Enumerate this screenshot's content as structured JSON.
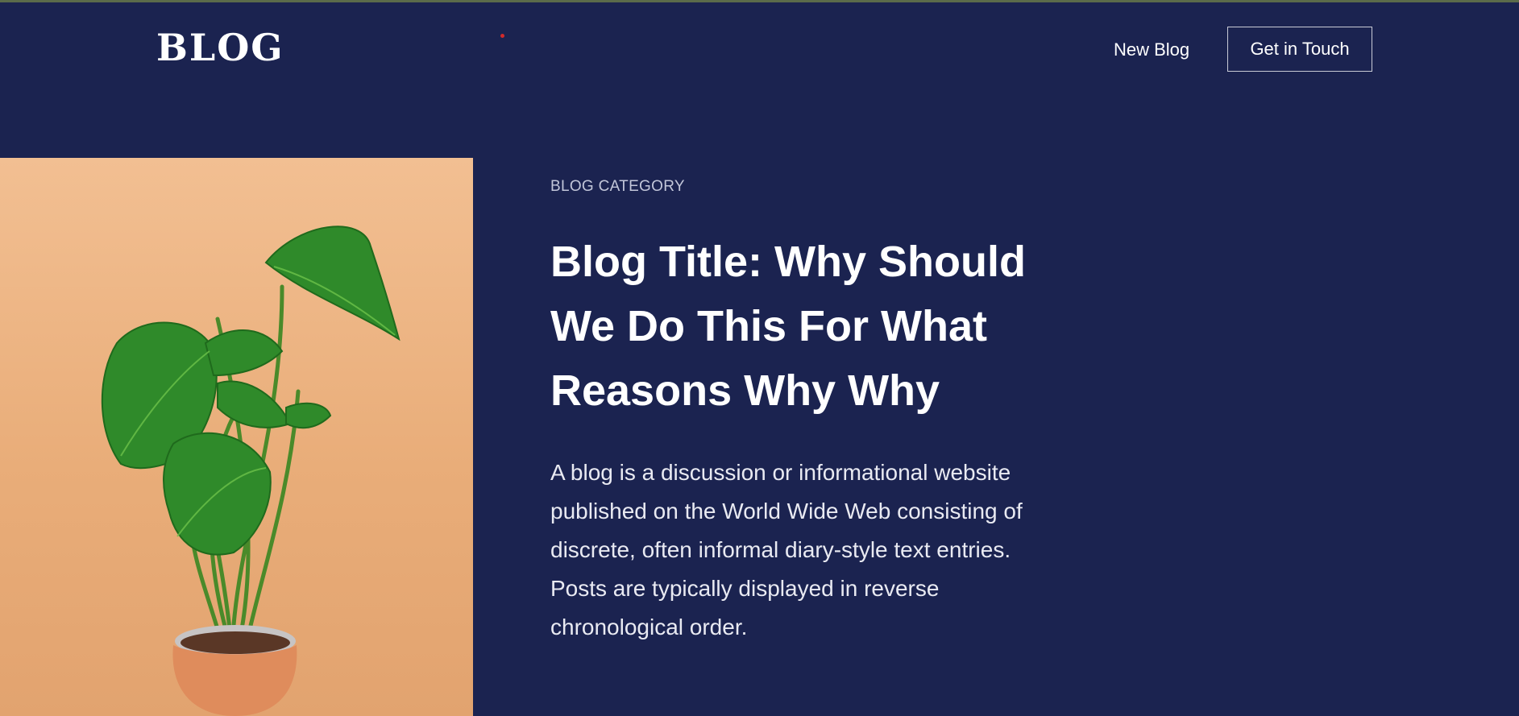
{
  "header": {
    "logo": "BLOG",
    "nav_link": "New Blog",
    "cta_label": "Get in Touch"
  },
  "hero": {
    "category": "BLOG CATEGORY",
    "title": "Blog Title: Why Should We Do This For What Reasons Why Why",
    "excerpt": "A blog is a discussion or informational website published on the World Wide Web consisting of discrete, often informal diary-style text entries. Posts are typically displayed in reverse chronological order.",
    "image_icon": "potted-monstera-plant"
  },
  "colors": {
    "background": "#1b2350",
    "text": "#ffffff",
    "image_background": "#eab07f",
    "leaf": "#2f8a2a",
    "pot": "#df8c5c"
  }
}
